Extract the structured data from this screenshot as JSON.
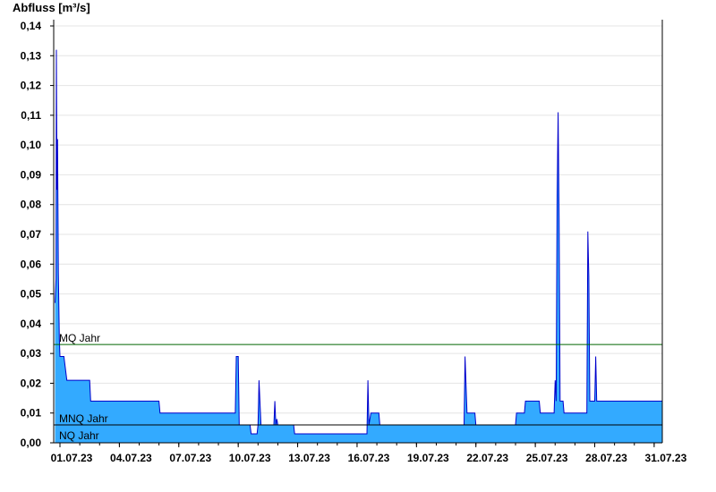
{
  "chart_data": {
    "type": "area",
    "ylabel": "Abfluss [m³/s]",
    "xlabel": "",
    "title": "",
    "ylim": [
      0,
      0.14
    ],
    "xlim": [
      0,
      30.55
    ],
    "yticks": [
      "0,00",
      "0,01",
      "0,02",
      "0,03",
      "0,04",
      "0,05",
      "0,06",
      "0,07",
      "0,08",
      "0,09",
      "0,10",
      "0,11",
      "0,12",
      "0,13",
      "0,14"
    ],
    "xticks": [
      {
        "day": 0,
        "label": "01.07.23"
      },
      {
        "day": 3,
        "label": "04.07.23"
      },
      {
        "day": 6,
        "label": "07.07.23"
      },
      {
        "day": 9,
        "label": "10.07.23"
      },
      {
        "day": 12,
        "label": "13.07.23"
      },
      {
        "day": 15,
        "label": "16.07.23"
      },
      {
        "day": 18,
        "label": "19.07.23"
      },
      {
        "day": 21,
        "label": "22.07.23"
      },
      {
        "day": 24,
        "label": "25.07.23"
      },
      {
        "day": 27,
        "label": "28.07.23"
      },
      {
        "day": 30,
        "label": "31.07.23"
      }
    ],
    "grid": true,
    "colors": {
      "fill": "#33aaff",
      "line": "#0000cc",
      "mq": "#006600",
      "ref": "#000000",
      "grid": "#e4e4e4"
    },
    "reference_lines": [
      {
        "label": "MQ Jahr",
        "value": 0.033
      },
      {
        "label": "MNQ Jahr",
        "value": 0.006
      },
      {
        "label": "NQ Jahr",
        "value": 0.0
      }
    ],
    "series": [
      {
        "values": [
          [
            -0.25,
            0.047
          ],
          [
            -0.2,
            0.055
          ],
          [
            -0.18,
            0.132
          ],
          [
            -0.15,
            0.085
          ],
          [
            -0.12,
            0.102
          ],
          [
            -0.08,
            0.057
          ],
          [
            -0.03,
            0.035
          ],
          [
            0.0,
            0.029
          ],
          [
            0.2,
            0.029
          ],
          [
            0.35,
            0.021
          ],
          [
            1.5,
            0.021
          ],
          [
            1.55,
            0.014
          ],
          [
            5.0,
            0.014
          ],
          [
            5.05,
            0.01
          ],
          [
            8.85,
            0.01
          ],
          [
            8.9,
            0.029
          ],
          [
            9.0,
            0.029
          ],
          [
            9.05,
            0.006
          ],
          [
            9.6,
            0.006
          ],
          [
            9.65,
            0.003
          ],
          [
            9.95,
            0.003
          ],
          [
            10.0,
            0.006
          ],
          [
            10.05,
            0.021
          ],
          [
            10.15,
            0.006
          ],
          [
            10.8,
            0.006
          ],
          [
            10.85,
            0.014
          ],
          [
            10.9,
            0.006
          ],
          [
            10.95,
            0.008
          ],
          [
            11.0,
            0.006
          ],
          [
            11.8,
            0.006
          ],
          [
            11.85,
            0.003
          ],
          [
            15.5,
            0.003
          ],
          [
            15.55,
            0.021
          ],
          [
            15.6,
            0.006
          ],
          [
            15.7,
            0.01
          ],
          [
            16.1,
            0.01
          ],
          [
            16.15,
            0.006
          ],
          [
            20.4,
            0.006
          ],
          [
            20.45,
            0.029
          ],
          [
            20.55,
            0.01
          ],
          [
            20.95,
            0.01
          ],
          [
            21.0,
            0.006
          ],
          [
            23.0,
            0.006
          ],
          [
            23.05,
            0.01
          ],
          [
            23.45,
            0.01
          ],
          [
            23.5,
            0.014
          ],
          [
            24.2,
            0.014
          ],
          [
            24.25,
            0.01
          ],
          [
            24.95,
            0.01
          ],
          [
            25.0,
            0.021
          ],
          [
            25.05,
            0.014
          ],
          [
            25.1,
            0.083
          ],
          [
            25.15,
            0.111
          ],
          [
            25.2,
            0.075
          ],
          [
            25.25,
            0.014
          ],
          [
            25.4,
            0.014
          ],
          [
            25.45,
            0.01
          ],
          [
            26.6,
            0.01
          ],
          [
            26.65,
            0.071
          ],
          [
            26.7,
            0.056
          ],
          [
            26.75,
            0.014
          ],
          [
            27.0,
            0.014
          ],
          [
            27.05,
            0.029
          ],
          [
            27.1,
            0.014
          ],
          [
            30.55,
            0.014
          ]
        ]
      }
    ]
  }
}
